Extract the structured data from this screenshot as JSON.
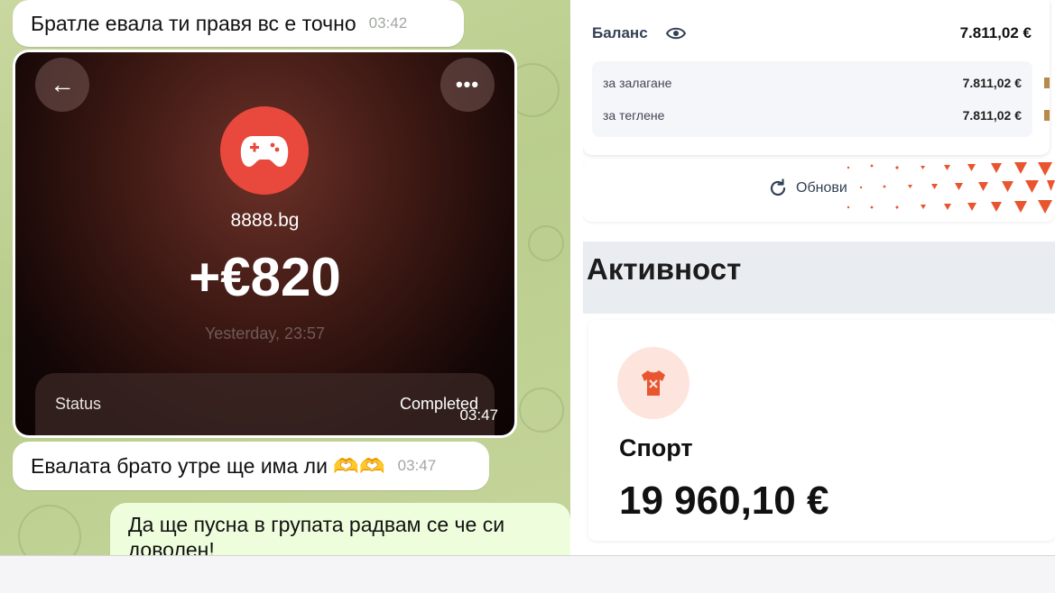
{
  "chat": {
    "msg1": {
      "text": "Братле евала ти правя вс е точно",
      "time": "03:42"
    },
    "photo": {
      "back_icon": "arrow-left-icon",
      "more_icon": "more-horizontal-icon",
      "site": "8888.bg",
      "amount": "+€820",
      "when": "Yesterday, 23:57",
      "status_label": "Status",
      "status_value": "Completed",
      "time": "03:47"
    },
    "msg2": {
      "text": "Евалата брато утре ще има ли 🫶🫶",
      "time": "03:47"
    },
    "msg3": {
      "text": "Да ще пусна в групата радвам се че си доволен!"
    }
  },
  "app": {
    "balance_label": "Баланс",
    "balance_value": "7.811,02 €",
    "rows": [
      {
        "label": "за залагане",
        "value": "7.811,02 €"
      },
      {
        "label": "за теглене",
        "value": "7.811,02 €"
      }
    ],
    "refresh_label": "Обнови",
    "activity_title": "Активност",
    "sport_label": "Спорт",
    "sport_value": "19 960,10 €"
  },
  "colors": {
    "chat_bg": "#c0d294",
    "accent_red": "#e9483d",
    "orange_triangles": "#e8552f",
    "outgoing_bubble": "#eefedc"
  }
}
